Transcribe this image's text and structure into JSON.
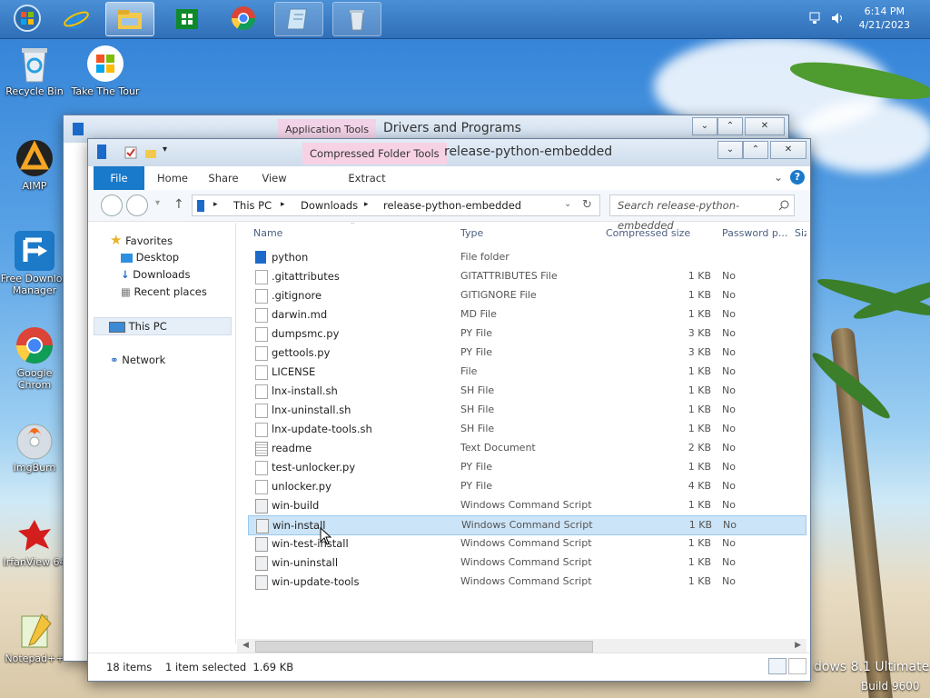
{
  "taskbar": {
    "clock_time": "6:14 PM",
    "clock_date": "4/21/2023",
    "buttons": [
      "start",
      "ie",
      "file-explorer",
      "store",
      "chrome",
      "notepad",
      "recycle"
    ]
  },
  "desktop_icons": [
    {
      "label": "Recycle Bin"
    },
    {
      "label": "Take The Tour"
    },
    {
      "label": "AIMP"
    },
    {
      "label": "Free Downloa Manager"
    },
    {
      "label": "Google Chrom"
    },
    {
      "label": "ImgBurn"
    },
    {
      "label": "IrfanView 64"
    },
    {
      "label": "Notepad++"
    }
  ],
  "watermark": {
    "line1": "dows 8.1 Ultimate",
    "line2": "Build 9600"
  },
  "back_window": {
    "context_tab": "Application Tools",
    "title": "Drivers and Programs"
  },
  "window": {
    "context_tab": "Compressed Folder Tools",
    "title": "release-python-embedded",
    "ribbon_tabs": [
      "File",
      "Home",
      "Share",
      "View",
      "Extract"
    ],
    "breadcrumb": [
      "This PC",
      "Downloads",
      "release-python-embedded"
    ],
    "search_placeholder": "Search release-python-embedded",
    "nav": {
      "favorites": "Favorites",
      "desktop": "Desktop",
      "downloads": "Downloads",
      "recent": "Recent places",
      "this_pc": "This PC",
      "network": "Network"
    },
    "columns": {
      "name": "Name",
      "type": "Type",
      "compressed_size": "Compressed size",
      "password": "Password p...",
      "size": "Siz"
    },
    "files": [
      {
        "name": "python",
        "type": "File folder",
        "size": "",
        "password": ""
      },
      {
        "name": ".gitattributes",
        "type": "GITATTRIBUTES File",
        "size": "1 KB",
        "password": "No"
      },
      {
        "name": ".gitignore",
        "type": "GITIGNORE File",
        "size": "1 KB",
        "password": "No"
      },
      {
        "name": "darwin.md",
        "type": "MD File",
        "size": "1 KB",
        "password": "No"
      },
      {
        "name": "dumpsmc.py",
        "type": "PY File",
        "size": "3 KB",
        "password": "No"
      },
      {
        "name": "gettools.py",
        "type": "PY File",
        "size": "3 KB",
        "password": "No"
      },
      {
        "name": "LICENSE",
        "type": "File",
        "size": "1 KB",
        "password": "No"
      },
      {
        "name": "lnx-install.sh",
        "type": "SH File",
        "size": "1 KB",
        "password": "No"
      },
      {
        "name": "lnx-uninstall.sh",
        "type": "SH File",
        "size": "1 KB",
        "password": "No"
      },
      {
        "name": "lnx-update-tools.sh",
        "type": "SH File",
        "size": "1 KB",
        "password": "No"
      },
      {
        "name": "readme",
        "type": "Text Document",
        "size": "2 KB",
        "password": "No"
      },
      {
        "name": "test-unlocker.py",
        "type": "PY File",
        "size": "1 KB",
        "password": "No"
      },
      {
        "name": "unlocker.py",
        "type": "PY File",
        "size": "4 KB",
        "password": "No"
      },
      {
        "name": "win-build",
        "type": "Windows Command Script",
        "size": "1 KB",
        "password": "No"
      },
      {
        "name": "win-install",
        "type": "Windows Command Script",
        "size": "1 KB",
        "password": "No",
        "selected": true
      },
      {
        "name": "win-test-install",
        "type": "Windows Command Script",
        "size": "1 KB",
        "password": "No"
      },
      {
        "name": "win-uninstall",
        "type": "Windows Command Script",
        "size": "1 KB",
        "password": "No"
      },
      {
        "name": "win-update-tools",
        "type": "Windows Command Script",
        "size": "1 KB",
        "password": "No"
      }
    ],
    "status": {
      "count": "18 items",
      "selection": "1 item selected  1.69 KB"
    }
  },
  "colors": {
    "file_tab": "#1979ca",
    "context_tab": "#f5d6e6",
    "selection": "#cce4f7"
  }
}
